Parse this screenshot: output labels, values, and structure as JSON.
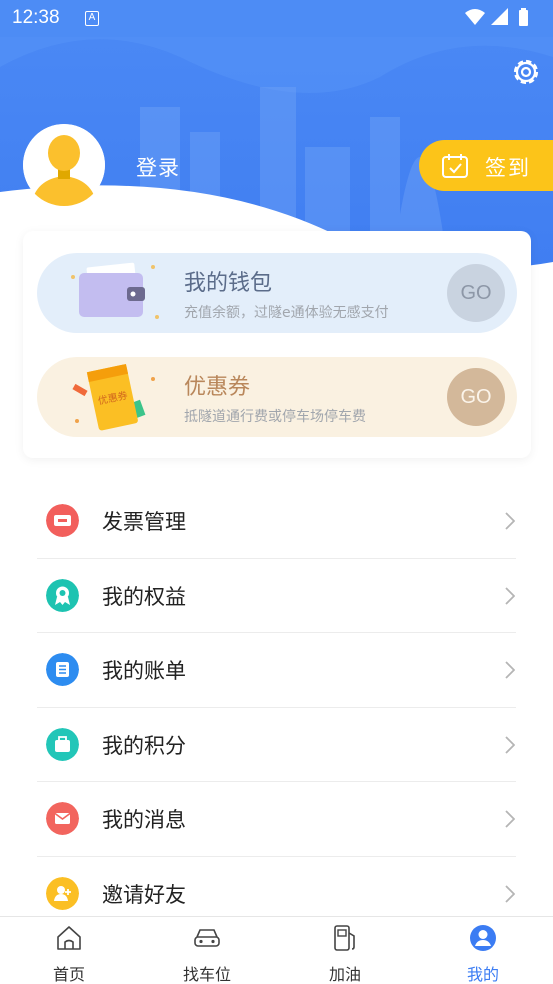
{
  "status_bar": {
    "time": "12:38",
    "notification_icon": "a-icon",
    "icons": [
      "wifi-icon",
      "signal-icon",
      "battery-icon"
    ]
  },
  "header": {
    "login_label": "登录",
    "checkin_label": "签到",
    "settings_icon": "gear-icon"
  },
  "wallet_card": {
    "wallet": {
      "title": "我的钱包",
      "subtitle": "充值余额，过隧e通体验无感支付",
      "go_label": "GO"
    },
    "coupon": {
      "title": "优惠券",
      "subtitle": "抵隧道通行费或停车场停车费",
      "go_label": "GO",
      "illustration_text": "优惠券"
    }
  },
  "menu": [
    {
      "label": "发票管理",
      "icon": "ticket-icon",
      "color": "#f25f5c"
    },
    {
      "label": "我的权益",
      "icon": "badge-icon",
      "color": "#1ec3b1"
    },
    {
      "label": "我的账单",
      "icon": "bill-icon",
      "color": "#2d8cf0"
    },
    {
      "label": "我的积分",
      "icon": "bag-icon",
      "color": "#22c6b8"
    },
    {
      "label": "我的消息",
      "icon": "mail-icon",
      "color": "#f2655e"
    },
    {
      "label": "邀请好友",
      "icon": "add-friend-icon",
      "color": "#fbbf24"
    }
  ],
  "bottom_nav": [
    {
      "label": "首页",
      "icon": "home-icon",
      "active": false
    },
    {
      "label": "找车位",
      "icon": "car-icon",
      "active": false
    },
    {
      "label": "加油",
      "icon": "fuel-icon",
      "active": false
    },
    {
      "label": "我的",
      "icon": "profile-icon",
      "active": true
    }
  ],
  "colors": {
    "primary": "#3b7cf3",
    "checkin": "#fcc419"
  }
}
